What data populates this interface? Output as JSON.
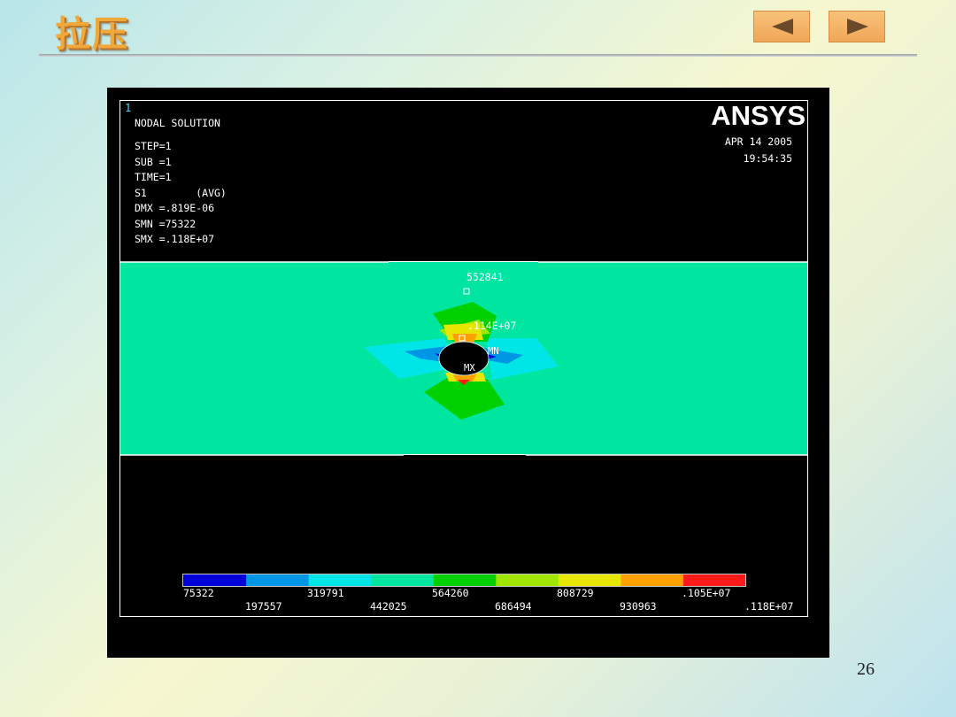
{
  "slide": {
    "title": "拉压",
    "page_number": "26",
    "nav": {
      "prev_icon": "triangle-left-icon",
      "next_icon": "triangle-right-icon"
    }
  },
  "ansys": {
    "window_number": "1",
    "brand": "ANSYS",
    "date": "APR 14 2005",
    "time": "19:54:35",
    "info_lines": [
      "NODAL SOLUTION",
      "STEP=1",
      "SUB =1",
      "TIME=1",
      "S1        (AVG)",
      "DMX =.819E-06",
      "SMN =75322",
      "SMX =.118E+07"
    ],
    "annotations": {
      "far_value": "552841",
      "near_value": ".114E+07",
      "mn_label": "MN",
      "mx_label": "MX"
    },
    "legend": {
      "colors": [
        "#0000d8",
        "#0096e6",
        "#00e6e6",
        "#00e6a0",
        "#00d000",
        "#a0e600",
        "#e6e600",
        "#ffa000",
        "#ff1a1a"
      ],
      "labels_top": [
        "75322",
        "319791",
        "564260",
        "808729",
        ".105E+07"
      ],
      "labels_bottom": [
        "197557",
        "442025",
        "686494",
        "930963",
        ".118E+07"
      ]
    },
    "colors": {
      "background": "#000000",
      "field": "#00e6a0",
      "text": "#ffffff"
    }
  }
}
